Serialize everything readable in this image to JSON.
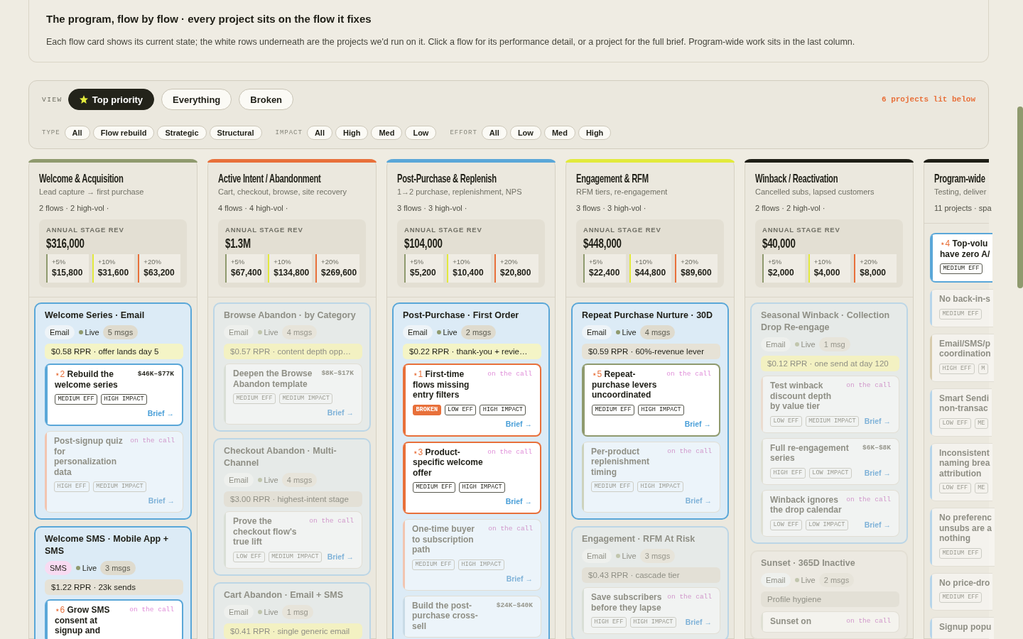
{
  "intro": {
    "title": "The program, flow by flow · every project sits on the flow it fixes",
    "text": "Each flow card shows its current state; the white rows underneath are the projects we'd run on it. Click a flow for its performance detail, or a project for the full brief. Program-wide work sits in the last column."
  },
  "filters": {
    "view_label": "VIEW",
    "views": [
      {
        "label": "Top priority",
        "kind": "priority",
        "selected": true
      },
      {
        "label": "Everything",
        "kind": "plain",
        "selected": false
      },
      {
        "label": "Broken",
        "kind": "plain",
        "selected": false
      }
    ],
    "lit_count": "6 projects lit below",
    "groups": [
      {
        "label": "TYPE",
        "options": [
          "All",
          "Flow rebuild",
          "Strategic",
          "Structural"
        ]
      },
      {
        "label": "IMPACT",
        "options": [
          "All",
          "High",
          "Med",
          "Low"
        ]
      },
      {
        "label": "EFFORT",
        "options": [
          "All",
          "Low",
          "Med",
          "High"
        ]
      }
    ]
  },
  "stages": [
    {
      "kind": "stage",
      "title": "Welcome & Acquisition",
      "subtitle": "Lead capture → first purchase",
      "meta": "2 flows · 2 high-vol ·",
      "color": "#8f9a6e",
      "revenue": {
        "label": "ANNUAL STAGE REV",
        "total": "$316,000",
        "uplifts": [
          {
            "pct": "+5%",
            "value": "$15,800",
            "color": "#8f9a6e"
          },
          {
            "pct": "+10%",
            "value": "$31,600",
            "color": "#e2ea3c"
          },
          {
            "pct": "+20%",
            "value": "$63,200",
            "color": "#e8703a"
          }
        ]
      },
      "flows": [
        {
          "kind": "revenue",
          "title": "Welcome Series · Email",
          "channel": {
            "text": "Email",
            "kind": "email"
          },
          "live": true,
          "status": "Live",
          "messages": "5 msgs",
          "rpr": "$0.58 RPR · offer lands day 5",
          "rpr_highlight": true,
          "lit": true,
          "projects": [
            {
              "rank": "⋆2",
              "title": "Rebuild the welcome series",
              "note": {
                "text": "$46K–$77K",
                "kind": "range"
              },
              "tags": [
                {
                  "text": "MEDIUM EFF",
                  "kind": "plain"
                },
                {
                  "text": "HIGH IMPACT",
                  "kind": "plain"
                }
              ],
              "brief": "Brief →",
              "lit": true,
              "color": "#5aa7d8"
            },
            {
              "title": "Post-signup quiz for personalization data",
              "note": {
                "text": "on the call",
                "kind": "call"
              },
              "tags": [
                {
                  "text": "HIGH EFF",
                  "kind": "plain"
                },
                {
                  "text": "MEDIUM IMPACT",
                  "kind": "plain"
                }
              ],
              "brief": "Brief →",
              "lit": false,
              "color": "#f2c5b0"
            }
          ]
        },
        {
          "kind": "revenue",
          "title": "Welcome SMS · Mobile App + SMS",
          "channel": {
            "text": "SMS",
            "kind": "sms"
          },
          "live": true,
          "status": "Live",
          "messages": "3 msgs",
          "rpr": "$1.22 RPR · 23k sends",
          "rpr_highlight": false,
          "lit": true,
          "projects": [
            {
              "rank": "⋆6",
              "title": "Grow SMS consent at signup and",
              "note": {
                "text": "on the call",
                "kind": "call"
              },
              "lit": true,
              "color": "#5aa7d8"
            }
          ]
        }
      ]
    },
    {
      "kind": "stage",
      "title": "Active Intent / Abandonment",
      "subtitle": "Cart, checkout, browse, site recovery",
      "meta": "4 flows · 4 high-vol ·",
      "color": "#e8703a",
      "revenue": {
        "label": "ANNUAL STAGE REV",
        "total": "$1.3M",
        "uplifts": [
          {
            "pct": "+5%",
            "value": "$67,400",
            "color": "#8f9a6e"
          },
          {
            "pct": "+10%",
            "value": "$134,800",
            "color": "#e2ea3c"
          },
          {
            "pct": "+20%",
            "value": "$269,600",
            "color": "#e8703a"
          }
        ]
      },
      "flows": [
        {
          "kind": "revenue",
          "title": "Browse Abandon · by Category",
          "channel": {
            "text": "Email",
            "kind": "email"
          },
          "live": true,
          "status": "Live",
          "messages": "4 msgs",
          "rpr": "$0.57 RPR · content depth opp…",
          "rpr_highlight": true,
          "lit": false,
          "projects": [
            {
              "title": "Deepen the Browse Abandon template",
              "note": {
                "text": "$8K–$17K",
                "kind": "range"
              },
              "tags": [
                {
                  "text": "MEDIUM EFF",
                  "kind": "plain"
                },
                {
                  "text": "MEDIUM IMPACT",
                  "kind": "plain"
                }
              ],
              "brief": "Brief →",
              "lit": false,
              "color": "#d9dfd6"
            }
          ]
        },
        {
          "kind": "revenue",
          "title": "Checkout Abandon · Multi-Channel",
          "channel": {
            "text": "Email",
            "kind": "email"
          },
          "live": true,
          "status": "Live",
          "messages": "4 msgs",
          "rpr": "$3.00 RPR · highest-intent stage",
          "rpr_highlight": false,
          "lit": false,
          "projects": [
            {
              "title": "Prove the checkout flow's true lift",
              "note": {
                "text": "on the call",
                "kind": "call"
              },
              "tags": [
                {
                  "text": "LOW EFF",
                  "kind": "plain"
                },
                {
                  "text": "MEDIUM IMPACT",
                  "kind": "plain"
                }
              ],
              "brief": "Brief →",
              "lit": false,
              "color": "#d9dfd6"
            }
          ]
        },
        {
          "kind": "revenue",
          "title": "Cart Abandon · Email + SMS",
          "channel": {
            "text": "Email",
            "kind": "email"
          },
          "live": true,
          "status": "Live",
          "messages": "1 msg",
          "rpr": "$0.41 RPR · single generic email",
          "rpr_highlight": true,
          "lit": false
        }
      ]
    },
    {
      "kind": "stage",
      "title": "Post-Purchase & Replenish",
      "subtitle": "1→2 purchase, replenishment, NPS",
      "meta": "3 flows · 3 high-vol ·",
      "color": "#5aa7d8",
      "revenue": {
        "label": "ANNUAL STAGE REV",
        "total": "$104,000",
        "uplifts": [
          {
            "pct": "+5%",
            "value": "$5,200",
            "color": "#8f9a6e"
          },
          {
            "pct": "+10%",
            "value": "$10,400",
            "color": "#e2ea3c"
          },
          {
            "pct": "+20%",
            "value": "$20,800",
            "color": "#e8703a"
          }
        ]
      },
      "flows": [
        {
          "kind": "revenue",
          "title": "Post-Purchase · First Order",
          "channel": {
            "text": "Email",
            "kind": "email"
          },
          "live": true,
          "status": "Live",
          "messages": "2 msgs",
          "rpr": "$0.22 RPR · thank-you + revie…",
          "rpr_highlight": true,
          "lit": true,
          "projects": [
            {
              "rank": "⋆1",
              "title": "First-time flows missing entry filters",
              "note": {
                "text": "on the call",
                "kind": "call"
              },
              "tags": [
                {
                  "text": "BROKEN",
                  "kind": "alert"
                },
                {
                  "text": "LOW EFF",
                  "kind": "plain"
                },
                {
                  "text": "HIGH IMPACT",
                  "kind": "plain"
                }
              ],
              "brief": "Brief →",
              "lit": true,
              "color": "#e8703a"
            },
            {
              "rank": "⋆3",
              "title": "Product-specific welcome offer",
              "note": {
                "text": "on the call",
                "kind": "call"
              },
              "tags": [
                {
                  "text": "MEDIUM EFF",
                  "kind": "plain"
                },
                {
                  "text": "HIGH IMPACT",
                  "kind": "plain"
                }
              ],
              "brief": "Brief →",
              "lit": true,
              "color": "#e8703a"
            },
            {
              "title": "One-time buyer to subscription path",
              "note": {
                "text": "on the call",
                "kind": "call"
              },
              "tags": [
                {
                  "text": "MEDIUM EFF",
                  "kind": "plain"
                },
                {
                  "text": "HIGH IMPACT",
                  "kind": "plain"
                }
              ],
              "brief": "Brief →",
              "lit": false,
              "color": "#f2c5b0"
            },
            {
              "title": "Build the post-purchase cross-sell",
              "note": {
                "text": "$24K–$40K",
                "kind": "range"
              },
              "lit": false,
              "color": "#c9dbe6"
            }
          ]
        }
      ]
    },
    {
      "kind": "stage",
      "title": "Engagement & RFM",
      "subtitle": "RFM tiers, re-engagement",
      "meta": "3 flows · 3 high-vol ·",
      "color": "#e2ea3c",
      "revenue": {
        "label": "ANNUAL STAGE REV",
        "total": "$448,000",
        "uplifts": [
          {
            "pct": "+5%",
            "value": "$22,400",
            "color": "#8f9a6e"
          },
          {
            "pct": "+10%",
            "value": "$44,800",
            "color": "#e2ea3c"
          },
          {
            "pct": "+20%",
            "value": "$89,600",
            "color": "#e8703a"
          }
        ]
      },
      "flows": [
        {
          "kind": "revenue",
          "title": "Repeat Purchase Nurture · 30D",
          "channel": {
            "text": "Email",
            "kind": "email"
          },
          "live": true,
          "status": "Live",
          "messages": "4 msgs",
          "rpr": "$0.59 RPR · 60%-revenue lever",
          "rpr_highlight": false,
          "lit": true,
          "projects": [
            {
              "rank": "⋆5",
              "title": "Repeat-purchase levers uncoordinated",
              "note": {
                "text": "on the call",
                "kind": "call"
              },
              "tags": [
                {
                  "text": "MEDIUM EFF",
                  "kind": "plain"
                },
                {
                  "text": "HIGH IMPACT",
                  "kind": "plain"
                }
              ],
              "brief": "Brief →",
              "lit": true,
              "color": "#8f9a6e"
            },
            {
              "title": "Per-product replenishment timing",
              "note": {
                "text": "on the call",
                "kind": "call"
              },
              "tags": [
                {
                  "text": "MEDIUM EFF",
                  "kind": "plain"
                },
                {
                  "text": "HIGH IMPACT",
                  "kind": "plain"
                }
              ],
              "brief": "Brief →",
              "lit": false,
              "color": "#cdd3bd"
            }
          ]
        },
        {
          "kind": "revenue",
          "title": "Engagement · RFM At Risk",
          "channel": {
            "text": "Email",
            "kind": "email"
          },
          "live": true,
          "status": "Live",
          "messages": "3 msgs",
          "rpr": "$0.43 RPR · cascade tier",
          "rpr_highlight": false,
          "lit": false,
          "projects": [
            {
              "title": "Save subscribers before they lapse",
              "note": {
                "text": "on the call",
                "kind": "call"
              },
              "tags": [
                {
                  "text": "HIGH EFF",
                  "kind": "plain"
                },
                {
                  "text": "HIGH IMPACT",
                  "kind": "plain"
                }
              ],
              "brief": "Brief →",
              "lit": false,
              "color": "#d9dfd6"
            }
          ]
        }
      ]
    },
    {
      "kind": "stage",
      "title": "Winback / Reactivation",
      "subtitle": "Cancelled subs, lapsed customers",
      "meta": "2 flows · 2 high-vol ·",
      "color": "#1e1e16",
      "revenue": {
        "label": "ANNUAL STAGE REV",
        "total": "$40,000",
        "uplifts": [
          {
            "pct": "+5%",
            "value": "$2,000",
            "color": "#8f9a6e"
          },
          {
            "pct": "+10%",
            "value": "$4,000",
            "color": "#e2ea3c"
          },
          {
            "pct": "+20%",
            "value": "$8,000",
            "color": "#e8703a"
          }
        ]
      },
      "flows": [
        {
          "kind": "revenue",
          "title": "Seasonal Winback · Collection Drop Re-engage",
          "channel": {
            "text": "Email",
            "kind": "email"
          },
          "live": true,
          "status": "Live",
          "messages": "1 msg",
          "rpr": "$0.12 RPR · one send at day 120",
          "rpr_highlight": true,
          "lit": false,
          "projects": [
            {
              "title": "Test winback discount depth by value tier",
              "note": {
                "text": "on the call",
                "kind": "call"
              },
              "tags": [
                {
                  "text": "LOW EFF",
                  "kind": "plain"
                },
                {
                  "text": "MEDIUM IMPACT",
                  "kind": "plain"
                }
              ],
              "brief": "Brief →",
              "lit": false,
              "color": "#ebdccf"
            },
            {
              "title": "Full re-engagement series",
              "note": {
                "text": "$6K–$8K",
                "kind": "range"
              },
              "tags": [
                {
                  "text": "HIGH EFF",
                  "kind": "plain"
                },
                {
                  "text": "LOW IMPACT",
                  "kind": "plain"
                }
              ],
              "brief": "Brief →",
              "lit": false,
              "color": "#dfe0d4"
            },
            {
              "title": "Winback ignores the drop calendar",
              "note": {
                "text": "on the call",
                "kind": "call"
              },
              "tags": [
                {
                  "text": "LOW EFF",
                  "kind": "plain"
                },
                {
                  "text": "LOW IMPACT",
                  "kind": "plain"
                }
              ],
              "brief": "Brief →",
              "lit": false,
              "color": "#dfe0d4"
            }
          ]
        },
        {
          "kind": "hygiene",
          "title": "Sunset · 365D Inactive",
          "channel": {
            "text": "Email",
            "kind": "email"
          },
          "live": true,
          "status": "Live",
          "messages": "2 msgs",
          "rpr": "Profile hygiene",
          "rpr_highlight": false,
          "lit": false,
          "projects": [
            {
              "title": "Sunset on",
              "note": {
                "text": "on the call",
                "kind": "call"
              },
              "lit": false,
              "color": "#dfe0d4"
            }
          ]
        }
      ]
    },
    {
      "kind": "program",
      "title": "Program-wide",
      "subtitle": "Testing, deliver",
      "meta": "11 projects · spa",
      "color": "#1e1e16",
      "projects": [
        {
          "rank": "⋆4",
          "title": "Top-volu\nhave zero A/",
          "tags": [
            {
              "text": "MEDIUM EFF",
              "kind": "plain"
            }
          ],
          "lit": true,
          "color": "#5aa7d8"
        },
        {
          "title": "No back-in-s",
          "tags": [
            {
              "text": "MEDIUM EFF",
              "kind": "plain"
            }
          ],
          "lit": false,
          "color": "#b7d5ea"
        },
        {
          "title": "Email/SMS/p\ncoordination",
          "tags": [
            {
              "text": "HIGH EFF",
              "kind": "plain"
            },
            {
              "text": "M",
              "kind": "plain"
            }
          ],
          "lit": false,
          "color": "#d8ccae"
        },
        {
          "title": "Smart Sendi\nnon-transac",
          "tags": [
            {
              "text": "LOW EFF",
              "kind": "plain"
            },
            {
              "text": "ME",
              "kind": "plain"
            }
          ],
          "lit": false,
          "color": "#b7d5ea"
        },
        {
          "title": "Inconsistent\nnaming brea\nattribution",
          "tags": [
            {
              "text": "LOW EFF",
              "kind": "plain"
            },
            {
              "text": "ME",
              "kind": "plain"
            }
          ],
          "lit": false,
          "color": "#b7d5ea"
        },
        {
          "title": "No preferenc\nunsubs are a\nnothing",
          "tags": [
            {
              "text": "MEDIUM EFF",
              "kind": "plain"
            }
          ],
          "lit": false,
          "color": "#b7d5ea"
        },
        {
          "title": "No price-dro",
          "tags": [
            {
              "text": "MEDIUM EFF",
              "kind": "plain"
            }
          ],
          "lit": false,
          "color": "#b7d5ea"
        },
        {
          "title": "Signup popu",
          "lit": false,
          "color": "#b7d5ea"
        }
      ]
    }
  ]
}
